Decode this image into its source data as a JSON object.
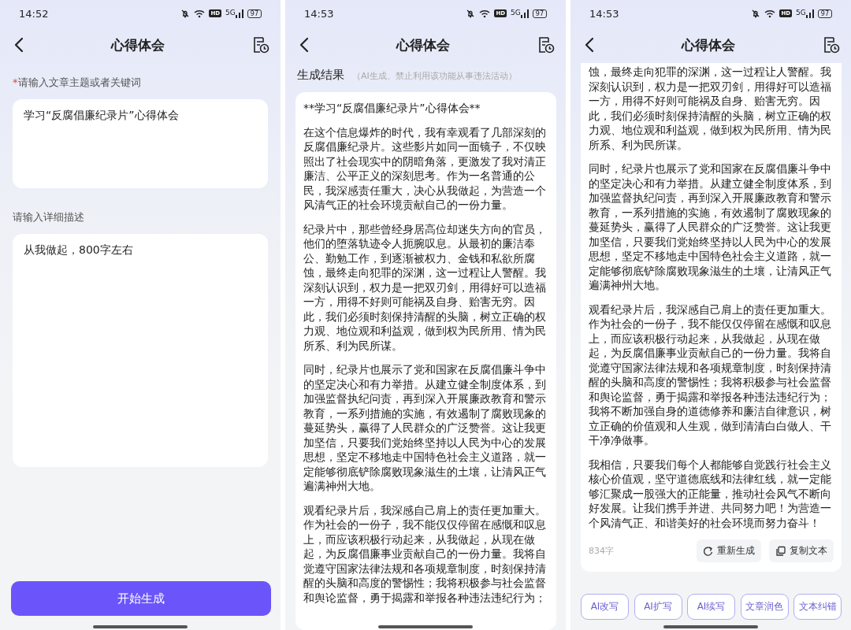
{
  "screens": [
    {
      "kind": "form",
      "status_bar": {
        "time": "14:52",
        "hd": "HD",
        "network": "5G",
        "battery": "97"
      },
      "header": {
        "title": "心得体会"
      },
      "fields": [
        {
          "required_mark": "*",
          "label": "请输入文章主题或者关键词",
          "value": "学习“反腐倡廉纪录片”心得体会"
        },
        {
          "label": "请输入详细描述",
          "value": "从我做起，800字左右"
        }
      ],
      "primary_button": "开始生成"
    },
    {
      "kind": "result",
      "status_bar": {
        "time": "14:53",
        "hd": "HD",
        "network": "5G",
        "battery": "97"
      },
      "header": {
        "title": "心得体会"
      },
      "result_heading": "生成结果",
      "disclaimer": "（AI生成、禁止利用该功能从事违法活动）",
      "paragraphs": [
        "**学习“反腐倡廉纪录片”心得体会**",
        "在这个信息爆炸的时代，我有幸观看了几部深刻的反腐倡廉纪录片。这些影片如同一面镜子，不仅映照出了社会现实中的阴暗角落，更激发了我对清正廉洁、公平正义的深刻思考。作为一名普通的公民，我深感责任重大，决心从我做起，为营造一个风清气正的社会环境贡献自己的一份力量。",
        "纪录片中，那些曾经身居高位却迷失方向的官员，他们的堕落轨迹令人扼腕叹息。从最初的廉洁奉公、勤勉工作，到逐渐被权力、金钱和私欲所腐蚀，最终走向犯罪的深渊，这一过程让人警醒。我深刻认识到，权力是一把双刃剑，用得好可以造福一方，用得不好则可能祸及自身、贻害无穷。因此，我们必须时刻保持清醒的头脑，树立正确的权力观、地位观和利益观，做到权为民所用、情为民所系、利为民所谋。",
        "同时，纪录片也展示了党和国家在反腐倡廉斗争中的坚定决心和有力举措。从建立健全制度体系，到加强监督执纪问责，再到深入开展廉政教育和警示教育，一系列措施的实施，有效遏制了腐败现象的蔓延势头，赢得了人民群众的广泛赞誉。这让我更加坚信，只要我们党始终坚持以人民为中心的发展思想，坚定不移地走中国特色社会主义道路，就一定能够彻底铲除腐败现象滋生的土壤，让清风正气遍满神州大地。",
        "观看纪录片后，我深感自己肩上的责任更加重大。作为社会的一份子，我不能仅仅停留在感慨和叹息上，而应该积极行动起来，从我做起，从现在做起，为反腐倡廉事业贡献自己的一份力量。我将自觉遵守国家法律法规和各项规章制度，时刻保持清醒的头脑和高度的警惕性；我将积极参与社会监督和舆论监督，勇于揭露和举报各种违法违纪行为；"
      ]
    },
    {
      "kind": "result",
      "status_bar": {
        "time": "14:53",
        "hd": "HD",
        "network": "5G",
        "battery": "97"
      },
      "header": {
        "title": "心得体会"
      },
      "paragraphs": [
        "蚀，最终走向犯罪的深渊，这一过程让人警醒。我深刻认识到，权力是一把双刃剑，用得好可以造福一方，用得不好则可能祸及自身、贻害无穷。因此，我们必须时刻保持清醒的头脑，树立正确的权力观、地位观和利益观，做到权为民所用、情为民所系、利为民所谋。",
        "同时，纪录片也展示了党和国家在反腐倡廉斗争中的坚定决心和有力举措。从建立健全制度体系，到加强监督执纪问责，再到深入开展廉政教育和警示教育，一系列措施的实施，有效遏制了腐败现象的蔓延势头，赢得了人民群众的广泛赞誉。这让我更加坚信，只要我们党始终坚持以人民为中心的发展思想，坚定不移地走中国特色社会主义道路，就一定能够彻底铲除腐败现象滋生的土壤，让清风正气遍满神州大地。",
        "观看纪录片后，我深感自己肩上的责任更加重大。作为社会的一份子，我不能仅仅停留在感慨和叹息上，而应该积极行动起来，从我做起，从现在做起，为反腐倡廉事业贡献自己的一份力量。我将自觉遵守国家法律法规和各项规章制度，时刻保持清醒的头脑和高度的警惕性；我将积极参与社会监督和舆论监督，勇于揭露和举报各种违法违纪行为；我将不断加强自身的道德修养和廉洁自律意识，树立正确的价值观和人生观，做到清清白白做人、干干净净做事。",
        "我相信，只要我们每个人都能够自觉践行社会主义核心价值观，坚守道德底线和法律红线，就一定能够汇聚成一股强大的正能量，推动社会风气不断向好发展。让我们携手并进、共同努力吧！为营造一个风清气正、和谐美好的社会环境而努力奋斗！"
      ],
      "char_count": "834字",
      "actions": [
        {
          "kind": "regenerate",
          "label": "重新生成"
        },
        {
          "kind": "copy",
          "label": "复制文本"
        }
      ],
      "tools": [
        "AI改写",
        "AI扩写",
        "AI续写",
        "文章润色",
        "文本纠错"
      ]
    }
  ]
}
